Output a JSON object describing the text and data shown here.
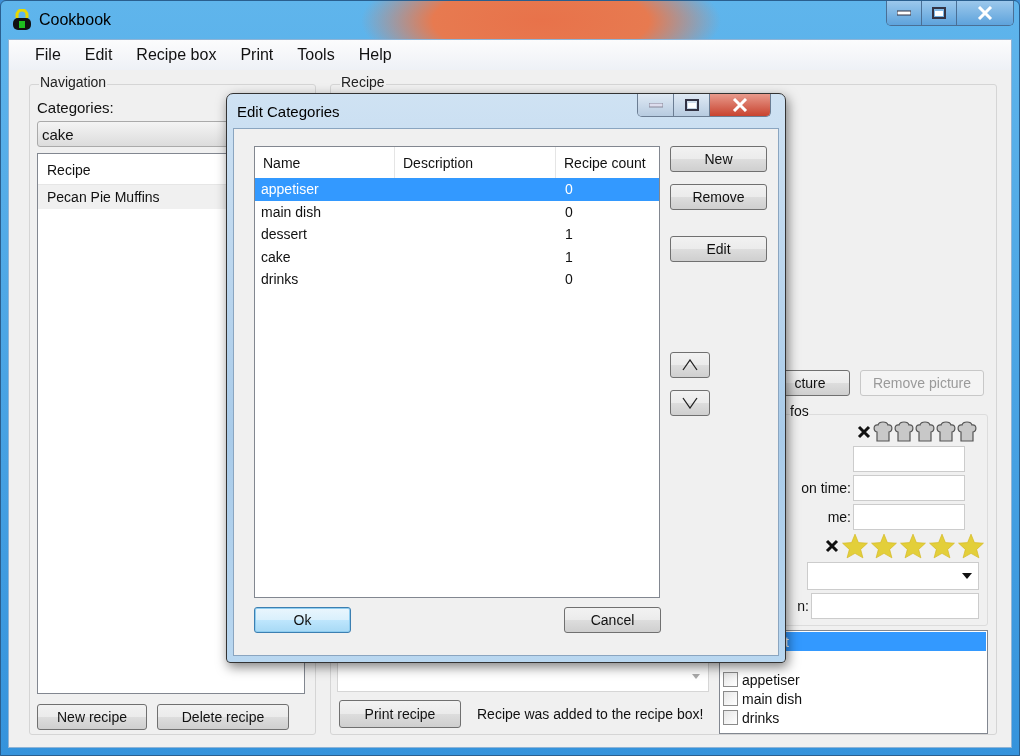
{
  "window": {
    "title": "Cookbook"
  },
  "menu": [
    {
      "label": "File"
    },
    {
      "label": "Edit"
    },
    {
      "label": "Recipe box"
    },
    {
      "label": "Print"
    },
    {
      "label": "Tools"
    },
    {
      "label": "Help"
    }
  ],
  "navigation": {
    "title": "Navigation",
    "categories_label": "Categories:",
    "category": "cake",
    "list_header": "Recipe",
    "recipes": [
      {
        "name": "Pecan Pie Muffins",
        "selected": false
      }
    ],
    "buttons": [
      "New recipe",
      "Delete recipe"
    ]
  },
  "recipe": {
    "title": "Recipe",
    "picture_buttons": [
      {
        "label": "cture",
        "disabled": false
      },
      {
        "label": "Remove picture",
        "disabled": true
      }
    ],
    "infos_title": "fos",
    "difficulty": {
      "stars": 0
    },
    "fields": [
      {
        "label": "on time:"
      },
      {
        "label": "me:"
      }
    ],
    "rating": {
      "stars": 5
    },
    "field_label": "n:",
    "category_items": [
      {
        "kind": "row",
        "label": "t",
        "selected": true
      },
      {
        "kind": "checkbox",
        "label": "appetiser",
        "checked": false,
        "selected": false
      },
      {
        "kind": "checkbox",
        "label": "main dish",
        "checked": false,
        "selected": false
      },
      {
        "kind": "checkbox",
        "label": "drinks",
        "checked": false,
        "selected": false
      }
    ],
    "print_button": "Print recipe",
    "status": "Recipe was added to the recipe box!"
  },
  "dialog": {
    "title": "Edit Categories",
    "columns": [
      "Name",
      "Description",
      "Recipe count"
    ],
    "rows": [
      {
        "name": "appetiser",
        "count": "0",
        "selected": true
      },
      {
        "name": "main dish",
        "count": "0",
        "selected": false
      },
      {
        "name": "dessert",
        "count": "1",
        "selected": false
      },
      {
        "name": "cake",
        "count": "1",
        "selected": false
      },
      {
        "name": "drinks",
        "count": "0",
        "selected": false
      }
    ],
    "buttons": [
      {
        "label": "New"
      },
      {
        "label": "Remove"
      },
      {
        "label": "Edit"
      }
    ],
    "ok": {
      "label": "Ok",
      "default": true
    },
    "cancel": {
      "label": "Cancel",
      "default": false
    }
  }
}
